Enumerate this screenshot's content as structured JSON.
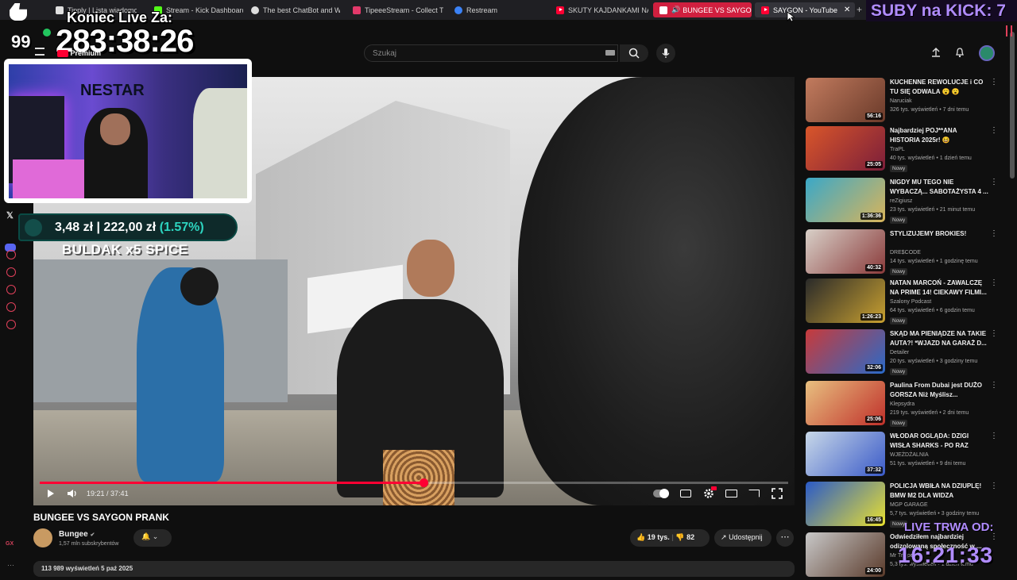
{
  "browser": {
    "tabs": [
      {
        "label": "Tipply | Lista wiadomości",
        "fav": "tipply-icon",
        "color": "#e0e0e0"
      },
      {
        "label": "Stream - Kick Dashboard",
        "fav": "kick-icon",
        "color": "#53fc18"
      },
      {
        "label": "The best ChatBot and W",
        "fav": "bot-icon",
        "color": "#dddddd"
      },
      {
        "label": "TipeeeStream - Collect T",
        "fav": "tipeee-icon",
        "color": "#e2396a"
      },
      {
        "label": "Restream",
        "fav": "restream-icon",
        "color": "#3b82f6"
      },
      {
        "label": "SKUTY KAJDANKAMI NA",
        "fav": "youtube-icon",
        "color": "#ff0033"
      },
      {
        "label": "BUNGEE VS SAYGON",
        "fav": "youtube-icon",
        "color": "#ff0033"
      },
      {
        "label": "SAYGON - YouTube",
        "fav": "youtube-icon",
        "color": "#ff0033"
      }
    ],
    "new_tab": "+",
    "close": "✕"
  },
  "search": {
    "placeholder": "Szukaj",
    "value": ""
  },
  "player": {
    "elapsed": "19:21",
    "duration": "37:41",
    "progress_fraction": 0.513
  },
  "video": {
    "title": "BUNGEE VS SAYGON PRANK",
    "channel": "Bungee",
    "subscribers": "1,57 mln subskrybentów",
    "likes": "19 tys.",
    "dislikes": "82",
    "share_label": "Udostępnij",
    "views_date": "113 989 wyświetleń  5 paź 2025"
  },
  "recommendations": [
    {
      "title": "KUCHENNE REWOLUCJE i CO TU SIĘ ODWALA 😮 😮",
      "channel": "Naruciak",
      "meta": "326 tys. wyświetleń • 7 dni temu",
      "duration": "56:16",
      "badge": "",
      "thumb": [
        "#c27b5e",
        "#6a3a2a"
      ]
    },
    {
      "title": "Najbardziej POJ**ANA HISTORIA 2025r! 😆",
      "channel": "TraPL",
      "meta": "40 tys. wyświetleń • 1 dzień temu",
      "duration": "25:05",
      "badge": "Nowy",
      "thumb": [
        "#d9562a",
        "#7b1e3a"
      ]
    },
    {
      "title": "NIGDY MU TEGO NIE WYBACZĄ... SABOTAŻYSTA 4 ...",
      "channel": "reZigiusz",
      "meta": "23 tys. wyświetleń • 21 minut temu",
      "duration": "1:36:36",
      "badge": "Nowy",
      "thumb": [
        "#3aa8c8",
        "#d8b45a"
      ]
    },
    {
      "title": "STYLIZUJEMY BROKIES!",
      "channel": "DRE$CODE",
      "meta": "14 tys. wyświetleń • 1 godzinę temu",
      "duration": "40:32",
      "badge": "Nowy",
      "thumb": [
        "#d8d0c8",
        "#8a3a3a"
      ]
    },
    {
      "title": "NATAN MARCOŃ - ZAWALCZĘ NA PRIME 14! CIEKAWY FILMI...",
      "channel": "Szalony Podcast",
      "meta": "64 tys. wyświetleń • 6 godzin temu",
      "duration": "1:26:23",
      "badge": "Nowy",
      "thumb": [
        "#2a2a2a",
        "#c8a030"
      ]
    },
    {
      "title": "SKĄD MA PIENIĄDZE NA TAKIE AUTA?! *WJAZD NA GARAŻ D...",
      "channel": "Detailer",
      "meta": "20 tys. wyświetleń • 3 godziny temu",
      "duration": "32:06",
      "badge": "Nowy",
      "thumb": [
        "#c83a3a",
        "#2a6ac8"
      ]
    },
    {
      "title": "Paulina From Dubai jest DUŻO GORSZA Niż Myślisz...",
      "channel": "Klepsydra",
      "meta": "219 tys. wyświetleń • 2 dni temu",
      "duration": "25:06",
      "badge": "Nowy",
      "thumb": [
        "#e8c080",
        "#c0302a"
      ]
    },
    {
      "title": "WŁODAR OGLĄDA: DZIGI WISŁA SHARKS - PO RAZ TRZECI",
      "channel": "WJEŻDŻALNIA",
      "meta": "51 tys. wyświetleń • 9 dni temu",
      "duration": "37:32",
      "badge": "",
      "thumb": [
        "#c8d8e8",
        "#3a5ac8"
      ]
    },
    {
      "title": "POLICJA WBIŁA NA DZIUPLĘ! BMW M2 DLA WIDZA",
      "channel": "MGP GARAGE",
      "meta": "5,7 tys. wyświetleń • 3 godziny temu",
      "duration": "16:45",
      "badge": "Nowy",
      "thumb": [
        "#2a5ac8",
        "#e8e030"
      ]
    },
    {
      "title": "Odwiedziłem najbardziej odizolowaną społeczność w ...",
      "channel": "Mr Tripper",
      "meta": "5,3 tys. wyświetleń • 1 dzień temu",
      "duration": "24:00",
      "badge": "",
      "thumb": [
        "#c8c8c8",
        "#5a3a2a"
      ]
    }
  ],
  "overlays": {
    "countdown_label": "Koniec Live Za:",
    "countdown_time": "283:38:26",
    "like_count": "99",
    "subs_banner": "SUBY na KICK: 7",
    "donation_left": "3,48 zł",
    "donation_sep": "|",
    "donation_right": "222,00 zł",
    "donation_pct": "(1.57%)",
    "caption": "BULDAK x5 SPICE",
    "live_label": "LIVE TRWA OD:",
    "live_time": "16:21:33",
    "yt_premium": "Premium",
    "cam_sign": "NESTAR"
  },
  "colors": {
    "accent": "#ff0033",
    "overlay_purple": "#b18cff",
    "donation_teal": "#2dd4bf"
  }
}
